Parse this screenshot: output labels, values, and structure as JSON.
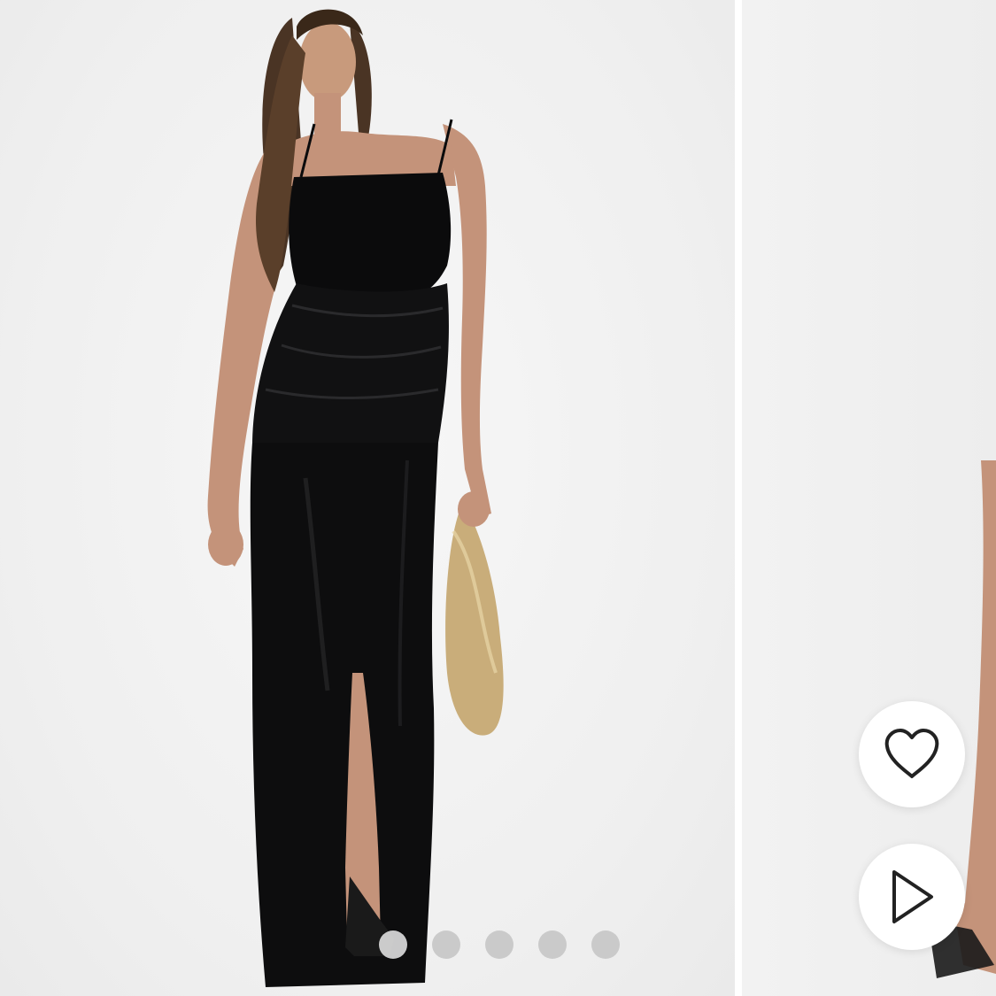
{
  "gallery": {
    "slides": [
      {
        "subject": "model-full-length",
        "dress_color": "#0b0b0c",
        "bag_color": "#c9ad7a"
      },
      {
        "subject": "model-partial-next-slide"
      }
    ],
    "pager": {
      "count": 5,
      "active_index": 0
    }
  },
  "actions": {
    "favorite_icon": "heart-outline-icon",
    "play_icon": "play-outline-icon"
  },
  "colors": {
    "background": "#f0f0f0",
    "button_bg": "#ffffff",
    "icon_stroke": "#222222"
  }
}
